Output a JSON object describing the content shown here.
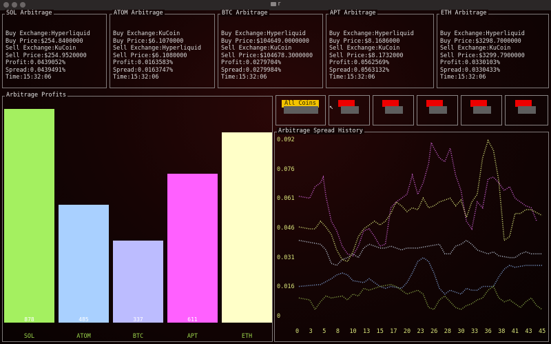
{
  "window": {
    "title": "r"
  },
  "coins": [
    {
      "title": "SOL Arbitrage",
      "rows": [
        {
          "label": "Buy Exchange:",
          "value": "Hyperliquid"
        },
        {
          "label": "Buy Price:",
          "value": "$254.8400000"
        },
        {
          "label": "Sell Exchange:",
          "value": "KuCoin"
        },
        {
          "label": "Sell Price:",
          "value": "$254.9520000"
        },
        {
          "label": "Profit:",
          "value": "0.0439052%"
        },
        {
          "label": "Spread:",
          "value": "0.0439491%"
        },
        {
          "label": "Time:",
          "value": "15:32:06"
        }
      ]
    },
    {
      "title": "ATOM Arbitrage",
      "rows": [
        {
          "label": "Buy Exchange:",
          "value": "KuCoin"
        },
        {
          "label": "Buy Price:",
          "value": "$6.1070000"
        },
        {
          "label": "Sell Exchange:",
          "value": "Hyperliquid"
        },
        {
          "label": "Sell Price:",
          "value": "$6.1080000"
        },
        {
          "label": "Profit:",
          "value": "0.0163583%"
        },
        {
          "label": "Spread:",
          "value": "0.0163747%"
        },
        {
          "label": "Time:",
          "value": "15:32:06"
        }
      ]
    },
    {
      "title": "BTC Arbitrage",
      "rows": [
        {
          "label": "Buy Exchange:",
          "value": "Hyperliquid"
        },
        {
          "label": "Buy Price:",
          "value": "$104649.0000000"
        },
        {
          "label": "Sell Exchange:",
          "value": "KuCoin"
        },
        {
          "label": "Sell Price:",
          "value": "$104678.3000000"
        },
        {
          "label": "Profit:",
          "value": "0.0279704%"
        },
        {
          "label": "Spread:",
          "value": "0.0279984%"
        },
        {
          "label": "Time:",
          "value": "15:32:06"
        }
      ]
    },
    {
      "title": "APT Arbitrage",
      "rows": [
        {
          "label": "Buy Exchange:",
          "value": "Hyperliquid"
        },
        {
          "label": "Buy Price:",
          "value": "$8.1686000"
        },
        {
          "label": "Sell Exchange:",
          "value": "KuCoin"
        },
        {
          "label": "Sell Price:",
          "value": "$8.1732000"
        },
        {
          "label": "Profit:",
          "value": "0.0562569%"
        },
        {
          "label": "Spread:",
          "value": "0.0563132%"
        },
        {
          "label": "Time:",
          "value": "15:32:06"
        }
      ]
    },
    {
      "title": "ETH Arbitrage",
      "rows": [
        {
          "label": "Buy Exchange:",
          "value": "Hyperliquid"
        },
        {
          "label": "Buy Price:",
          "value": "$3298.7000000"
        },
        {
          "label": "Sell Exchange:",
          "value": "KuCoin"
        },
        {
          "label": "Sell Price:",
          "value": "$3299.7900000"
        },
        {
          "label": "Profit:",
          "value": "0.0330103%"
        },
        {
          "label": "Spread:",
          "value": "0.0330433%"
        },
        {
          "label": "Time:",
          "value": "15:32:06"
        }
      ]
    }
  ],
  "profits_panel": {
    "title": "Arbitrage Profits"
  },
  "history_panel": {
    "title": "Arbitrage Spread History"
  },
  "buttons": {
    "all_coins": "All Coins"
  },
  "colors": {
    "accent_yellow": "#f4c400",
    "button_red": "#ee0000",
    "button_gray": "#5e5e5e"
  },
  "chart_data": [
    {
      "type": "bar",
      "categories": [
        "SOL",
        "ATOM",
        "BTC",
        "APT",
        "ETH"
      ],
      "values": [
        878,
        485,
        337,
        611,
        782
      ],
      "colors": [
        "#a4f060",
        "#a9d0ff",
        "#bcbcff",
        "#ff60ff",
        "#ffffc8"
      ],
      "value_labels": [
        "878",
        "485",
        "337",
        "611",
        ""
      ],
      "ylim": [
        0,
        900
      ]
    },
    {
      "type": "line",
      "y_ticks": [
        "0.092",
        "0.076",
        "0.061",
        "0.046",
        "0.031",
        "0.016",
        "0"
      ],
      "x_ticks": [
        "0",
        "3",
        "5",
        "8",
        "10",
        "13",
        "15",
        "17",
        "20",
        "23",
        "26",
        "28",
        "30",
        "33",
        "36",
        "38",
        "41",
        "43",
        "45"
      ],
      "ylim": [
        0,
        0.092
      ],
      "xlim": [
        0,
        45
      ],
      "series": [
        {
          "color": "#c85fd0",
          "points": [
            [
              0,
              0.063
            ],
            [
              2,
              0.062
            ],
            [
              3,
              0.068
            ],
            [
              4,
              0.07
            ],
            [
              4.5,
              0.073
            ],
            [
              5,
              0.063
            ],
            [
              6,
              0.05
            ],
            [
              7,
              0.045
            ],
            [
              8,
              0.037
            ],
            [
              9,
              0.033
            ],
            [
              10,
              0.032
            ],
            [
              11,
              0.037
            ],
            [
              12,
              0.045
            ],
            [
              13,
              0.046
            ],
            [
              14,
              0.042
            ],
            [
              15,
              0.037
            ],
            [
              16,
              0.038
            ],
            [
              17,
              0.057
            ],
            [
              18,
              0.06
            ],
            [
              19,
              0.062
            ],
            [
              20,
              0.064
            ],
            [
              21,
              0.074
            ],
            [
              22,
              0.064
            ],
            [
              23,
              0.07
            ],
            [
              24,
              0.08
            ],
            [
              24.5,
              0.091
            ],
            [
              25,
              0.088
            ],
            [
              26,
              0.083
            ],
            [
              27,
              0.081
            ],
            [
              28,
              0.088
            ],
            [
              29,
              0.074
            ],
            [
              30,
              0.066
            ],
            [
              31,
              0.05
            ],
            [
              32,
              0.046
            ],
            [
              33,
              0.06
            ],
            [
              34,
              0.057
            ],
            [
              35,
              0.072
            ],
            [
              36,
              0.073
            ],
            [
              37,
              0.07
            ],
            [
              38,
              0.066
            ],
            [
              39,
              0.068
            ],
            [
              40,
              0.062
            ],
            [
              42,
              0.058
            ],
            [
              43,
              0.057
            ],
            [
              44,
              0.05
            ]
          ]
        },
        {
          "color": "#b8c4d4",
          "points": [
            [
              0,
              0.04
            ],
            [
              2,
              0.039
            ],
            [
              4,
              0.038
            ],
            [
              5,
              0.035
            ],
            [
              6,
              0.028
            ],
            [
              7,
              0.027
            ],
            [
              8,
              0.03
            ],
            [
              9,
              0.031
            ],
            [
              10,
              0.033
            ],
            [
              11,
              0.031
            ],
            [
              12,
              0.036
            ],
            [
              13,
              0.038
            ],
            [
              14,
              0.037
            ],
            [
              15,
              0.036
            ],
            [
              16,
              0.036
            ],
            [
              17,
              0.037
            ],
            [
              18,
              0.036
            ],
            [
              19,
              0.035
            ],
            [
              20,
              0.036
            ],
            [
              22,
              0.036
            ],
            [
              24,
              0.037
            ],
            [
              26,
              0.038
            ],
            [
              27,
              0.033
            ],
            [
              28,
              0.033
            ],
            [
              29,
              0.037
            ],
            [
              30,
              0.038
            ],
            [
              31,
              0.04
            ],
            [
              32,
              0.038
            ],
            [
              33,
              0.035
            ],
            [
              34,
              0.034
            ],
            [
              35,
              0.033
            ],
            [
              36,
              0.034
            ],
            [
              37,
              0.032
            ],
            [
              39,
              0.031
            ],
            [
              40,
              0.031
            ],
            [
              41,
              0.033
            ],
            [
              42,
              0.034
            ],
            [
              43,
              0.033
            ],
            [
              45,
              0.033
            ]
          ]
        },
        {
          "color": "#d8e37a",
          "points": [
            [
              0,
              0.047
            ],
            [
              2,
              0.046
            ],
            [
              3,
              0.046
            ],
            [
              4,
              0.05
            ],
            [
              5,
              0.047
            ],
            [
              6,
              0.043
            ],
            [
              7,
              0.035
            ],
            [
              8,
              0.03
            ],
            [
              9,
              0.029
            ],
            [
              10,
              0.034
            ],
            [
              11,
              0.042
            ],
            [
              12,
              0.046
            ],
            [
              13,
              0.048
            ],
            [
              14,
              0.05
            ],
            [
              15,
              0.048
            ],
            [
              16,
              0.05
            ],
            [
              17,
              0.054
            ],
            [
              18,
              0.06
            ],
            [
              19,
              0.058
            ],
            [
              20,
              0.055
            ],
            [
              21,
              0.057
            ],
            [
              22,
              0.056
            ],
            [
              23,
              0.062
            ],
            [
              24,
              0.057
            ],
            [
              25,
              0.058
            ],
            [
              26,
              0.06
            ],
            [
              28,
              0.062
            ],
            [
              29,
              0.058
            ],
            [
              30,
              0.061
            ],
            [
              31,
              0.052
            ],
            [
              32,
              0.06
            ],
            [
              33,
              0.064
            ],
            [
              34,
              0.083
            ],
            [
              35,
              0.092
            ],
            [
              36,
              0.087
            ],
            [
              37,
              0.071
            ],
            [
              38,
              0.04
            ],
            [
              39,
              0.042
            ],
            [
              40,
              0.054
            ],
            [
              41,
              0.054
            ],
            [
              42,
              0.056
            ],
            [
              43,
              0.056
            ],
            [
              45,
              0.053
            ]
          ]
        },
        {
          "color": "#7fa2d8",
          "points": [
            [
              0,
              0.016
            ],
            [
              4,
              0.017
            ],
            [
              6,
              0.02
            ],
            [
              7,
              0.022
            ],
            [
              8,
              0.023
            ],
            [
              9,
              0.022
            ],
            [
              10,
              0.019
            ],
            [
              12,
              0.018
            ],
            [
              13,
              0.02
            ],
            [
              14,
              0.018
            ],
            [
              15,
              0.016
            ],
            [
              16,
              0.015
            ],
            [
              17,
              0.016
            ],
            [
              19,
              0.015
            ],
            [
              20,
              0.018
            ],
            [
              21,
              0.023
            ],
            [
              22,
              0.029
            ],
            [
              23,
              0.031
            ],
            [
              24,
              0.029
            ],
            [
              25,
              0.023
            ],
            [
              26,
              0.015
            ],
            [
              27,
              0.012
            ],
            [
              28,
              0.014
            ],
            [
              29,
              0.013
            ],
            [
              30,
              0.012
            ],
            [
              31,
              0.015
            ],
            [
              32,
              0.014
            ],
            [
              33,
              0.014
            ],
            [
              34,
              0.016
            ],
            [
              36,
              0.016
            ],
            [
              37,
              0.021
            ],
            [
              38,
              0.025
            ],
            [
              39,
              0.027
            ],
            [
              40,
              0.026
            ],
            [
              42,
              0.027
            ],
            [
              45,
              0.027
            ]
          ]
        },
        {
          "color": "#8fae4a",
          "points": [
            [
              0,
              0.01
            ],
            [
              2,
              0.009
            ],
            [
              3,
              0.004
            ],
            [
              4,
              0.008
            ],
            [
              5,
              0.011
            ],
            [
              6,
              0.01
            ],
            [
              8,
              0.011
            ],
            [
              9,
              0.009
            ],
            [
              10,
              0.012
            ],
            [
              11,
              0.011
            ],
            [
              12,
              0.015
            ],
            [
              13,
              0.014
            ],
            [
              15,
              0.016
            ],
            [
              17,
              0.017
            ],
            [
              18,
              0.016
            ],
            [
              19,
              0.014
            ],
            [
              20,
              0.012
            ],
            [
              21,
              0.013
            ],
            [
              22,
              0.014
            ],
            [
              23,
              0.012
            ],
            [
              24,
              0.005
            ],
            [
              25,
              0.004
            ],
            [
              26,
              0.009
            ],
            [
              27,
              0.011
            ],
            [
              28,
              0.008
            ],
            [
              29,
              0.005
            ],
            [
              30,
              0.004
            ],
            [
              31,
              0.006
            ],
            [
              32,
              0.007
            ],
            [
              33,
              0.009
            ],
            [
              34,
              0.01
            ],
            [
              35,
              0.014
            ],
            [
              36,
              0.016
            ],
            [
              37,
              0.01
            ],
            [
              38,
              0.008
            ],
            [
              39,
              0.009
            ],
            [
              40,
              0.007
            ],
            [
              41,
              0.005
            ],
            [
              42,
              0.008
            ],
            [
              43,
              0.01
            ],
            [
              44,
              0.006
            ],
            [
              45,
              0.004
            ]
          ]
        }
      ]
    }
  ]
}
